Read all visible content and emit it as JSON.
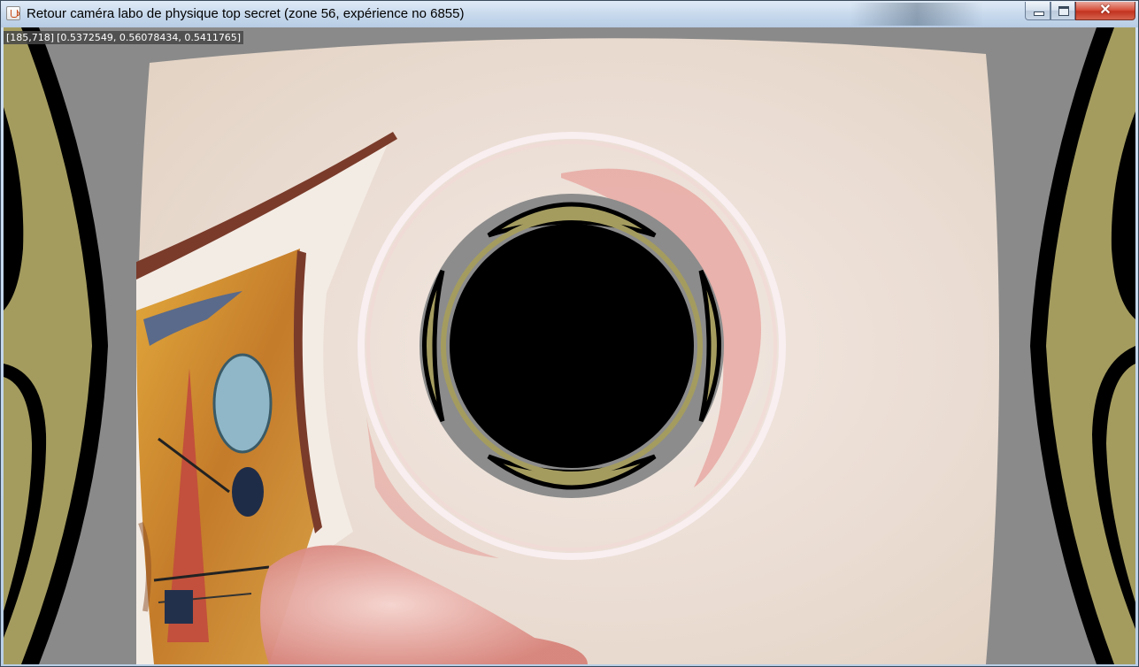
{
  "window": {
    "title": "Retour caméra labo de physique top secret (zone 56, expérience no 6855)",
    "icon": "java-cup-icon",
    "controls": {
      "minimize_icon": "minimize-icon",
      "maximize_icon": "maximize-icon",
      "close_glyph": "✕"
    }
  },
  "readout": {
    "pixel": "[185,718]",
    "color_value": "[0.5372549, 0.56078434, 0.5411765]"
  },
  "scene": {
    "description_icon": "camera-feed",
    "colors": {
      "wall": "#ece1d8",
      "band_grey": "#8a8a8a",
      "band_olive": "#a49c5f",
      "band_black": "#000000",
      "painting_red": "#c2503c",
      "painting_blue": "#8fb7c8",
      "painting_yellow": "#d89a2c",
      "frame_brown": "#7a3b2a",
      "skin": "#e6a39a"
    }
  }
}
